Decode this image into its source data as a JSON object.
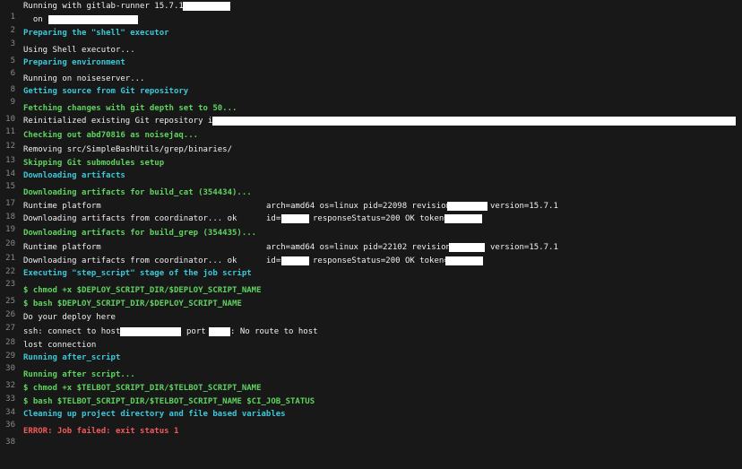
{
  "colors": {
    "background": "#181818",
    "normal": "#f0f0f0",
    "section_header": "#3cc8d8",
    "success": "#5fd35f",
    "error": "#f05a5a",
    "line_number": "#8a8a8a"
  },
  "lines": [
    {
      "n": "1",
      "text": "Running with gitlab-runner 15.7.1"
    },
    {
      "n": "2",
      "text": "  on"
    },
    {
      "n": "3",
      "text": "Preparing the \"shell\" executor"
    },
    {
      "n": "5",
      "text": "Using Shell executor..."
    },
    {
      "n": "6",
      "text": "Preparing environment"
    },
    {
      "n": "8",
      "text": "Running on noiseserver..."
    },
    {
      "n": "9",
      "text": "Getting source from Git repository"
    },
    {
      "n": "10",
      "text": "Fetching changes with git depth set to 50..."
    },
    {
      "n": "11",
      "text": "Reinitialized existing Git repository in"
    },
    {
      "n": "12",
      "text": "Checking out abd70816 as noisejaq..."
    },
    {
      "n": "13",
      "text": "Removing src/SimpleBashUtils/grep/binaries/"
    },
    {
      "n": "14",
      "text": "Skipping Git submodules setup"
    },
    {
      "n": "15",
      "text": "Downloading artifacts"
    },
    {
      "n": "17",
      "text": "Downloading artifacts for build_cat (354434)..."
    },
    {
      "n": "18",
      "text": "Runtime platform",
      "extra1": "arch=amd64 os=linux pid=22098 revision=",
      "extra2": "version=15.7.1"
    },
    {
      "n": "19",
      "text": "Downloading artifacts from coordinator... ok",
      "extra1": "id=",
      "extra2": "responseStatus=200 OK token="
    },
    {
      "n": "20",
      "text": "Downloading artifacts for build_grep (354435)..."
    },
    {
      "n": "21",
      "text": "Runtime platform",
      "extra1": "arch=amd64 os=linux pid=22102 revision=",
      "extra2": "version=15.7.1"
    },
    {
      "n": "22",
      "text": "Downloading artifacts from coordinator... ok",
      "extra1": "id=",
      "extra2": "responseStatus=200 OK token="
    },
    {
      "n": "23",
      "text": "Executing \"step_script\" stage of the job script"
    },
    {
      "n": "25",
      "text": "$ chmod +x $DEPLOY_SCRIPT_DIR/$DEPLOY_SCRIPT_NAME"
    },
    {
      "n": "26",
      "text": "$ bash $DEPLOY_SCRIPT_DIR/$DEPLOY_SCRIPT_NAME"
    },
    {
      "n": "27",
      "text": "Do your deploy here"
    },
    {
      "n": "28",
      "text": "ssh: connect to host",
      "extra1": "port",
      "extra2": ": No route to host"
    },
    {
      "n": "29",
      "text": "lost connection"
    },
    {
      "n": "30",
      "text": "Running after_script"
    },
    {
      "n": "32",
      "text": "Running after script..."
    },
    {
      "n": "33",
      "text": "$ chmod +x $TELBOT_SCRIPT_DIR/$TELBOT_SCRIPT_NAME"
    },
    {
      "n": "34",
      "text": "$ bash $TELBOT_SCRIPT_DIR/$TELBOT_SCRIPT_NAME $CI_JOB_STATUS"
    },
    {
      "n": "36",
      "text": "Cleaning up project directory and file based variables"
    },
    {
      "n": "38",
      "text": "ERROR: Job failed: exit status 1"
    }
  ]
}
